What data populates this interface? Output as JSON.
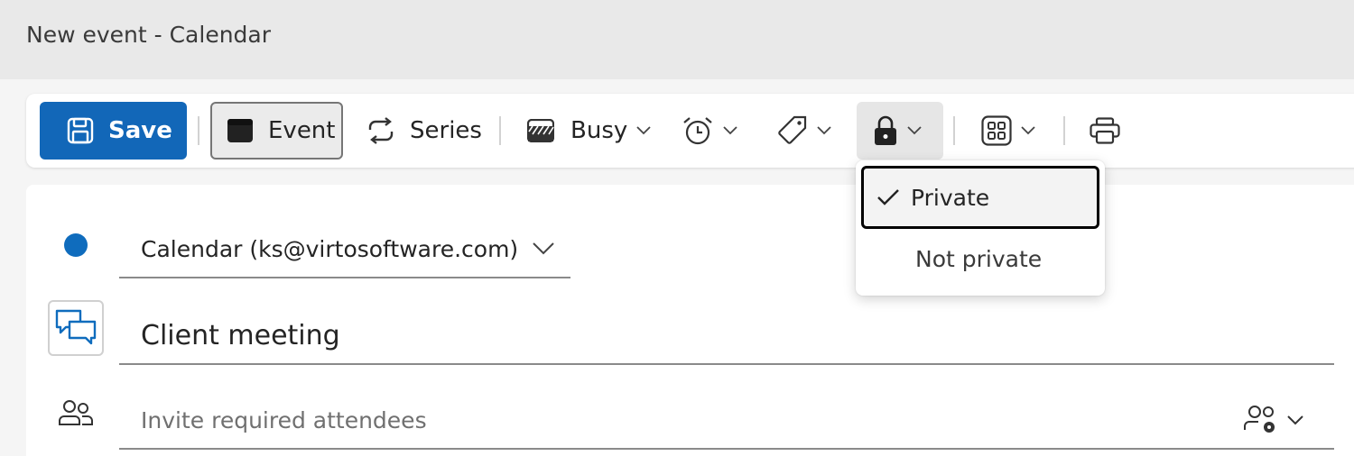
{
  "window": {
    "title": "New event - Calendar"
  },
  "toolbar": {
    "save_label": "Save",
    "event_label": "Event",
    "series_label": "Series",
    "busy_label": "Busy"
  },
  "privacy_menu": {
    "items": [
      {
        "label": "Private",
        "checked": true
      },
      {
        "label": "Not private",
        "checked": false
      }
    ]
  },
  "form": {
    "calendar_label": "Calendar (ks@virtosoftware.com)",
    "calendar_color": "#0f6cbd",
    "title_value": "Client meeting",
    "attendees_placeholder": "Invite required attendees"
  },
  "colors": {
    "accent": "#1267b8"
  },
  "icons": [
    "save-icon",
    "calendar-event-icon",
    "repeat-icon",
    "busy-icon",
    "alarm-icon",
    "tag-icon",
    "lock-icon",
    "apps-icon",
    "print-icon",
    "chat-icon",
    "people-icon",
    "people-settings-icon",
    "checkmark-icon",
    "chevron-down-icon"
  ]
}
